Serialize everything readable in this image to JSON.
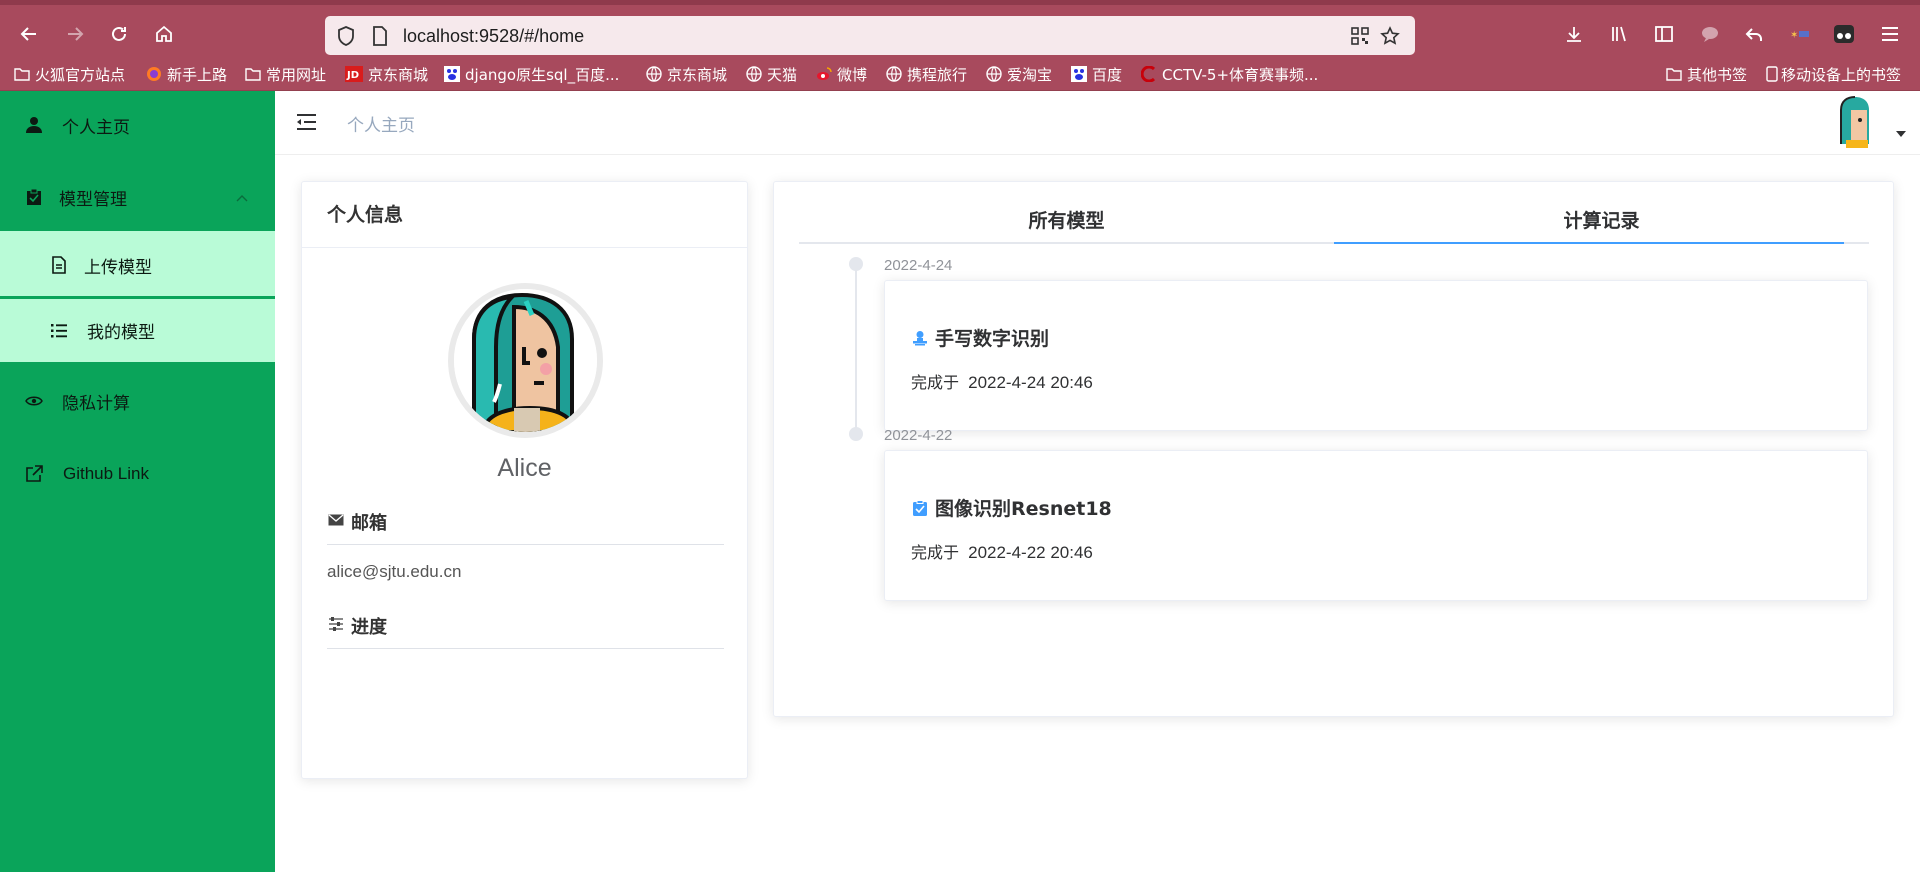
{
  "browser": {
    "url": "localhost:9528/#/home",
    "bookmarks": [
      {
        "label": "火狐官方站点",
        "icon": "folder-icon"
      },
      {
        "label": "新手上路",
        "icon": "firefox-icon"
      },
      {
        "label": "常用网址",
        "icon": "folder-icon"
      },
      {
        "label": "京东商城",
        "icon": "jd-icon"
      },
      {
        "label": "django原生sql_百度...",
        "icon": "baidu-icon"
      },
      {
        "label": "京东商城",
        "icon": "globe-icon"
      },
      {
        "label": "天猫",
        "icon": "globe-icon"
      },
      {
        "label": "微博",
        "icon": "weibo-icon"
      },
      {
        "label": "携程旅行",
        "icon": "globe-icon"
      },
      {
        "label": "爱淘宝",
        "icon": "globe-icon"
      },
      {
        "label": "百度",
        "icon": "baidu-icon"
      },
      {
        "label": "CCTV-5+体育赛事频...",
        "icon": "cctv-icon"
      },
      {
        "label": "其他书签",
        "icon": "folder-icon"
      },
      {
        "label": "移动设备上的书签",
        "icon": "phone-icon"
      }
    ]
  },
  "sidebar": {
    "items": [
      {
        "label": "个人主页",
        "icon": "user-icon"
      },
      {
        "label": "模型管理",
        "icon": "clipboard-icon"
      },
      {
        "label": "上传模型",
        "icon": "document-icon"
      },
      {
        "label": "我的模型",
        "icon": "list-icon"
      },
      {
        "label": "隐私计算",
        "icon": "eye-icon"
      },
      {
        "label": "Github Link",
        "icon": "external-link-icon"
      }
    ],
    "color": "#0aa45a",
    "sub_color": "#b9fbd7"
  },
  "header": {
    "breadcrumb": "个人主页"
  },
  "profile": {
    "title": "个人信息",
    "name": "Alice",
    "email_label": "邮箱",
    "email": "alice@sjtu.edu.cn",
    "progress_label": "进度"
  },
  "records": {
    "tabs": [
      "所有模型",
      "计算记录"
    ],
    "active_tab": "计算记录",
    "entries": [
      {
        "date": "2022-4-24",
        "title": "手写数字识别",
        "done_prefix": "完成于",
        "done_time": "2022-4-24 20:46",
        "icon": "user-stamp-icon"
      },
      {
        "date": "2022-4-22",
        "title": "图像识别Resnet18",
        "done_prefix": "完成于",
        "done_time": "2022-4-22 20:46",
        "icon": "clipboard-check-icon"
      }
    ],
    "accent": "#409eff"
  }
}
